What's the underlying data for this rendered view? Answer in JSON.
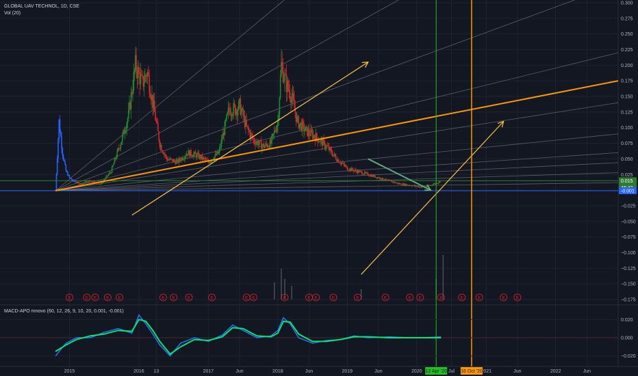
{
  "header": {
    "symbol_line": "GLOBAL UAV TECHNOL, 1D, CSE",
    "volume_label": "Vol (20)",
    "macd_label": "MACD-APO mnovo (60, 12, 26, 9, 10, 20, 0.001, -0.001)"
  },
  "colors": {
    "background": "#131722",
    "up": "#26a69a",
    "candle_up": "#1e8a2e",
    "candle_down": "#e0202a",
    "fib_fan": "#9598a1",
    "trend_orange": "#ff9800",
    "arrow_yellow": "#ffc53d",
    "arrow_green": "#5fa87c",
    "vline_green": "#22c022",
    "hline_blue": "#2962ff",
    "hline_green": "#2e7d32",
    "macd_zero": "#e0202a"
  },
  "chart_data": [
    {
      "type": "candlestick",
      "ylim": [
        -0.175,
        0.3
      ],
      "y_ticks": [
        "0.300",
        "0.275",
        "0.250",
        "0.225",
        "0.200",
        "0.175",
        "0.150",
        "0.125",
        "0.100",
        "0.075",
        "0.050",
        "0.025",
        "0.000",
        "−0.025",
        "−0.050",
        "−0.075",
        "−0.100",
        "−0.125",
        "−0.150",
        "−0.175"
      ],
      "y_tick_values": [
        0.3,
        0.275,
        0.25,
        0.225,
        0.2,
        0.175,
        0.15,
        0.125,
        0.1,
        0.075,
        0.05,
        0.025,
        0,
        -0.025,
        -0.05,
        -0.075,
        -0.1,
        -0.125,
        -0.15,
        -0.175
      ],
      "x_ticks": [
        "2015",
        "2016",
        "13",
        "2017",
        "Jun",
        "2018",
        "Jun",
        "2019",
        "Jun",
        "2020",
        "Jul",
        "2021",
        "Jun",
        "2022",
        "Jun"
      ],
      "x_tick_values": [
        2015.0,
        2016.0,
        2016.25,
        2017.0,
        2017.45,
        2018.0,
        2018.45,
        2019.0,
        2019.45,
        2020.0,
        2020.5,
        2021.0,
        2021.45,
        2022.0,
        2022.45
      ],
      "price_labels": [
        {
          "text": "0.015",
          "value": 0.015,
          "color": "#2e7d32"
        },
        {
          "text": "46:42",
          "value": 0.004,
          "color": "#2e7d32"
        },
        {
          "text": "-0.001",
          "value": -0.001,
          "color": "#2962ff"
        }
      ],
      "date_labels": [
        {
          "text": "12 Apr '20",
          "x": 2020.28,
          "color": "#22c022"
        },
        {
          "text": "16 Oct '20",
          "x": 2020.79,
          "color": "#ff9800"
        }
      ],
      "xlim": [
        2014.0,
        2022.9
      ],
      "price_path": [
        [
          2014.8,
          0.0
        ],
        [
          2014.85,
          0.11
        ],
        [
          2014.9,
          0.06
        ],
        [
          2014.95,
          0.03
        ],
        [
          2015.0,
          0.02
        ],
        [
          2015.05,
          0.015
        ],
        [
          2015.15,
          0.01
        ],
        [
          2015.3,
          0.015
        ],
        [
          2015.45,
          0.01
        ],
        [
          2015.6,
          0.03
        ],
        [
          2015.75,
          0.08
        ],
        [
          2015.85,
          0.12
        ],
        [
          2015.95,
          0.2
        ],
        [
          2016.05,
          0.17
        ],
        [
          2016.12,
          0.19
        ],
        [
          2016.2,
          0.14
        ],
        [
          2016.3,
          0.075
        ],
        [
          2016.4,
          0.05
        ],
        [
          2016.55,
          0.045
        ],
        [
          2016.7,
          0.06
        ],
        [
          2016.85,
          0.055
        ],
        [
          2017.0,
          0.045
        ],
        [
          2017.15,
          0.06
        ],
        [
          2017.3,
          0.13
        ],
        [
          2017.4,
          0.13
        ],
        [
          2017.45,
          0.135
        ],
        [
          2017.55,
          0.1
        ],
        [
          2017.65,
          0.08
        ],
        [
          2017.8,
          0.07
        ],
        [
          2017.9,
          0.075
        ],
        [
          2018.0,
          0.11
        ],
        [
          2018.05,
          0.2
        ],
        [
          2018.12,
          0.17
        ],
        [
          2018.2,
          0.15
        ],
        [
          2018.28,
          0.11
        ],
        [
          2018.4,
          0.095
        ],
        [
          2018.55,
          0.085
        ],
        [
          2018.7,
          0.07
        ],
        [
          2018.85,
          0.05
        ],
        [
          2019.0,
          0.035
        ],
        [
          2019.15,
          0.03
        ],
        [
          2019.3,
          0.025
        ],
        [
          2019.45,
          0.02
        ],
        [
          2019.6,
          0.015
        ],
        [
          2019.75,
          0.01
        ],
        [
          2019.9,
          0.008
        ],
        [
          2020.0,
          0.006
        ],
        [
          2020.1,
          0.005
        ],
        [
          2020.2,
          0.008
        ],
        [
          2020.3,
          0.012
        ],
        [
          2020.35,
          0.015
        ]
      ],
      "fib_fan_origin": [
        2014.8,
        -0.001
      ],
      "fib_fan_targets": [
        [
          2022.9,
          0.75
        ],
        [
          2022.9,
          0.5
        ],
        [
          2022.9,
          0.33
        ],
        [
          2022.9,
          0.22
        ],
        [
          2022.9,
          0.14
        ],
        [
          2022.9,
          0.09
        ],
        [
          2022.9,
          0.06
        ],
        [
          2022.9,
          0.044
        ],
        [
          2022.9,
          0.028
        ],
        [
          2022.9,
          0.012
        ]
      ],
      "orange_trendline": [
        [
          2014.8,
          -0.001
        ],
        [
          2022.9,
          0.175
        ]
      ],
      "orange_vline_x": 2020.79,
      "green_vline_x": 2020.28,
      "green_hline_y": 0.015,
      "blue_hline_y": -0.001,
      "yellow_arrows": [
        [
          [
            2015.9,
            -0.04
          ],
          [
            2019.3,
            0.205
          ]
        ],
        [
          [
            2019.2,
            -0.135
          ],
          [
            2021.25,
            0.11
          ]
        ]
      ],
      "green_arrow": [
        [
          2019.3,
          0.05
        ],
        [
          2020.2,
          0.0
        ]
      ],
      "volume_spikes": [
        [
          2017.95,
          0.05
        ],
        [
          2018.05,
          0.09
        ],
        [
          2018.1,
          0.06
        ],
        [
          2018.2,
          0.04
        ],
        [
          2019.2,
          0.03
        ],
        [
          2020.28,
          0.06
        ],
        [
          2020.38,
          0.13
        ]
      ],
      "earnings_markers": [
        2015.0,
        2015.25,
        2015.37,
        2015.55,
        2015.72,
        2016.35,
        2016.5,
        2016.72,
        2017.05,
        2017.55,
        2017.65,
        2018.1,
        2018.45,
        2018.55,
        2018.8,
        2019.15,
        2019.55,
        2019.9,
        2020.05,
        2020.35,
        2020.65,
        2020.9,
        2021.25,
        2021.45
      ]
    },
    {
      "type": "line",
      "title": "MACD-APO mnovo (60, 12, 26, 9, 10, 20, 0.001, -0.001)",
      "ylim": [
        -0.027,
        0.027
      ],
      "y_ticks": [
        "0.020",
        "0.000",
        "−0.020"
      ],
      "y_tick_values": [
        0.02,
        0.0,
        -0.02
      ],
      "series": [
        {
          "color": "#2979ff",
          "values": [
            [
              2014.8,
              -0.02
            ],
            [
              2014.95,
              -0.006
            ],
            [
              2015.1,
              0.0
            ],
            [
              2015.3,
              0.0
            ],
            [
              2015.5,
              0.006
            ],
            [
              2015.7,
              0.01
            ],
            [
              2015.9,
              0.005
            ],
            [
              2016.0,
              0.025
            ],
            [
              2016.1,
              0.015
            ],
            [
              2016.2,
              0.004
            ],
            [
              2016.3,
              -0.008
            ],
            [
              2016.45,
              -0.02
            ],
            [
              2016.6,
              -0.006
            ],
            [
              2016.8,
              0.0
            ],
            [
              2017.0,
              -0.004
            ],
            [
              2017.2,
              0.003
            ],
            [
              2017.35,
              0.014
            ],
            [
              2017.5,
              0.008
            ],
            [
              2017.7,
              0.0
            ],
            [
              2017.9,
              0.002
            ],
            [
              2018.0,
              0.008
            ],
            [
              2018.08,
              0.022
            ],
            [
              2018.18,
              0.015
            ],
            [
              2018.3,
              0.0
            ],
            [
              2018.5,
              -0.006
            ],
            [
              2018.7,
              -0.003
            ],
            [
              2018.9,
              -0.002
            ],
            [
              2019.1,
              0.002
            ],
            [
              2019.3,
              0.0
            ],
            [
              2019.6,
              0.001
            ],
            [
              2019.9,
              0.0
            ],
            [
              2020.1,
              0.0
            ],
            [
              2020.35,
              0.001
            ]
          ]
        },
        {
          "color": "#00e676",
          "values": [
            [
              2014.8,
              -0.015
            ],
            [
              2014.95,
              -0.008
            ],
            [
              2015.1,
              -0.002
            ],
            [
              2015.3,
              0.002
            ],
            [
              2015.5,
              0.004
            ],
            [
              2015.7,
              0.008
            ],
            [
              2015.9,
              0.007
            ],
            [
              2016.0,
              0.02
            ],
            [
              2016.1,
              0.018
            ],
            [
              2016.2,
              0.008
            ],
            [
              2016.3,
              -0.004
            ],
            [
              2016.45,
              -0.018
            ],
            [
              2016.6,
              -0.01
            ],
            [
              2016.8,
              -0.002
            ],
            [
              2017.0,
              -0.003
            ],
            [
              2017.2,
              0.001
            ],
            [
              2017.35,
              0.011
            ],
            [
              2017.5,
              0.01
            ],
            [
              2017.7,
              0.002
            ],
            [
              2017.9,
              0.001
            ],
            [
              2018.0,
              0.005
            ],
            [
              2018.08,
              0.018
            ],
            [
              2018.18,
              0.017
            ],
            [
              2018.3,
              0.004
            ],
            [
              2018.5,
              -0.004
            ],
            [
              2018.7,
              -0.004
            ],
            [
              2018.9,
              -0.002
            ],
            [
              2019.1,
              0.001
            ],
            [
              2019.3,
              0.001
            ],
            [
              2019.6,
              0.0
            ],
            [
              2019.9,
              0.0
            ],
            [
              2020.1,
              0.0
            ],
            [
              2020.35,
              0.0
            ]
          ]
        }
      ]
    }
  ]
}
